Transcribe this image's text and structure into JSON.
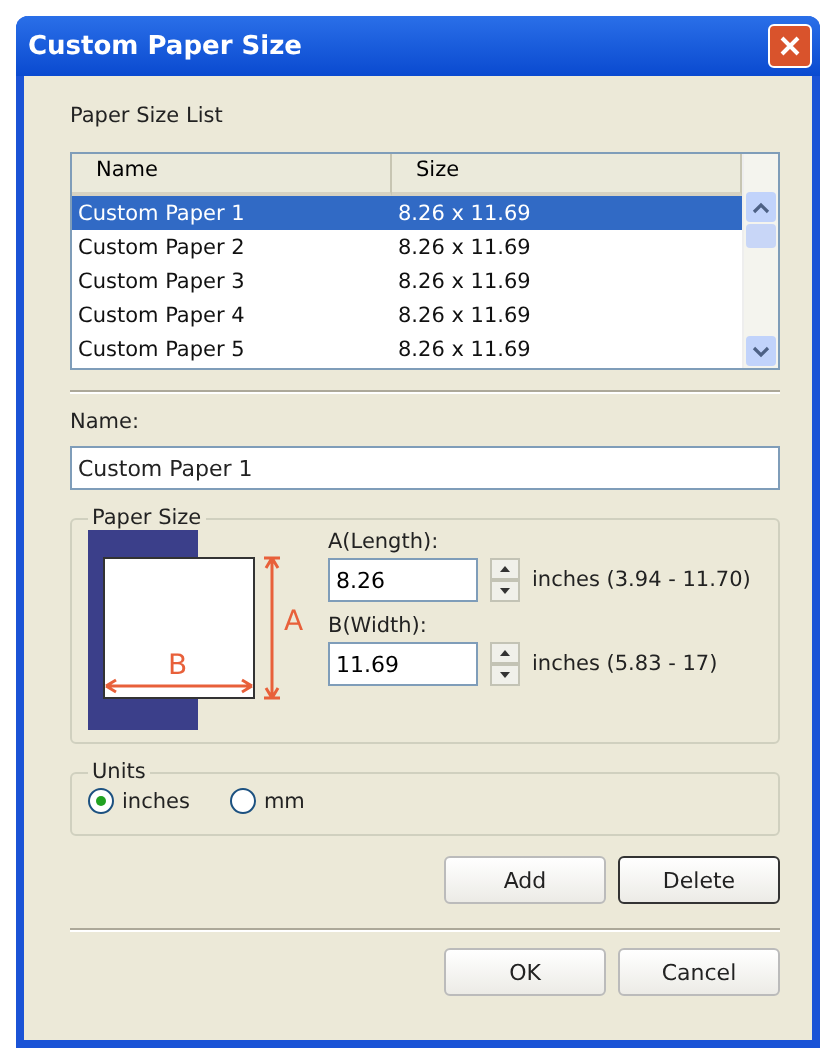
{
  "window": {
    "title": "Custom Paper Size"
  },
  "paper_size_list": {
    "label": "Paper Size List",
    "columns": [
      "Name",
      "Size"
    ],
    "rows": [
      {
        "name": "Custom Paper 1",
        "size": "8.26 x 11.69",
        "selected": true
      },
      {
        "name": "Custom Paper 2",
        "size": "8.26 x 11.69",
        "selected": false
      },
      {
        "name": "Custom Paper 3",
        "size": "8.26 x 11.69",
        "selected": false
      },
      {
        "name": "Custom Paper 4",
        "size": "8.26 x 11.69",
        "selected": false
      },
      {
        "name": "Custom Paper 5",
        "size": "8.26 x 11.69",
        "selected": false
      }
    ]
  },
  "name_field": {
    "label": "Name:",
    "value": "Custom Paper 1"
  },
  "paper_size": {
    "title": "Paper Size",
    "diagram_labels": [
      "A",
      "B"
    ],
    "fields": [
      {
        "label": "A(Length):",
        "value": "8.26",
        "range": "inches (3.94 - 11.70)"
      },
      {
        "label": "B(Width):",
        "value": "11.69",
        "range": "inches (5.83 - 17)"
      }
    ]
  },
  "units": {
    "title": "Units",
    "options": [
      {
        "label": "inches",
        "selected": true
      },
      {
        "label": "mm",
        "selected": false
      }
    ]
  },
  "buttons": [
    "Add",
    "Delete"
  ],
  "footer_buttons": [
    "OK",
    "Cancel"
  ]
}
